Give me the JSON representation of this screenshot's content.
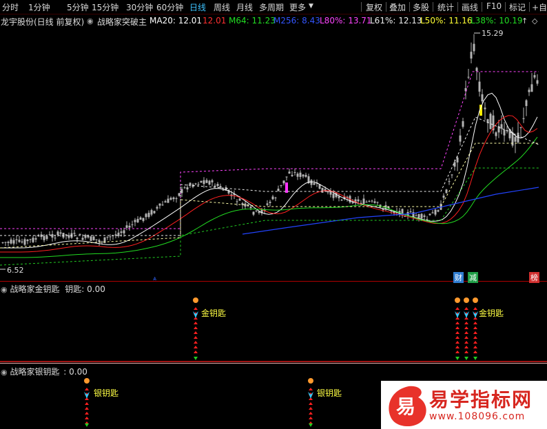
{
  "toolbar": {
    "periods": [
      "分时",
      "1分钟",
      "5分钟",
      "15分钟",
      "30分钟",
      "60分钟",
      "日线",
      "周线",
      "月线",
      "多周期",
      "更多"
    ],
    "active": "日线",
    "right": [
      "复权",
      "叠加",
      "多股",
      "统计",
      "画线",
      "F10",
      "标记",
      "+自选"
    ]
  },
  "header": {
    "stock": "龙宇股份(日线 前复权)",
    "indicator": "战略家突破主",
    "ma20": "MA20: 12.01",
    "val2": "12.01",
    "m64": "M64: 11.23",
    "m256": "M256: 8.43",
    "l80": "L80%: 13.71",
    "l61": "L61%: 12.13",
    "l50": "L50%: 11.16",
    "l38": "L38%: 10.19"
  },
  "main_chart": {
    "high_label": "15.29",
    "low_label": "6.52",
    "badges": [
      {
        "text": "财",
        "color": "#2f7dd1"
      },
      {
        "text": "减",
        "color": "#1f9e46"
      },
      {
        "text": "榜",
        "color": "#d12f2f"
      }
    ],
    "colors": {
      "ma20": "#ffffff",
      "m64": "#22dd22",
      "m256": "#2244ff",
      "up": "#ff2020",
      "candle": "#b4b4b4"
    }
  },
  "gold_panel": {
    "title": "战略家金钥匙",
    "value_label": "钥匙: 0.00",
    "signal_label": "金钥匙",
    "cluster_label": "金钥匙"
  },
  "silver_panel": {
    "title": "战略家银钥匙",
    "value_label": ": 0.00",
    "signal_label": "银钥匙"
  },
  "watermark": {
    "logo_char": "易",
    "brand": "易学指标网",
    "url": "www.108096.com"
  }
}
